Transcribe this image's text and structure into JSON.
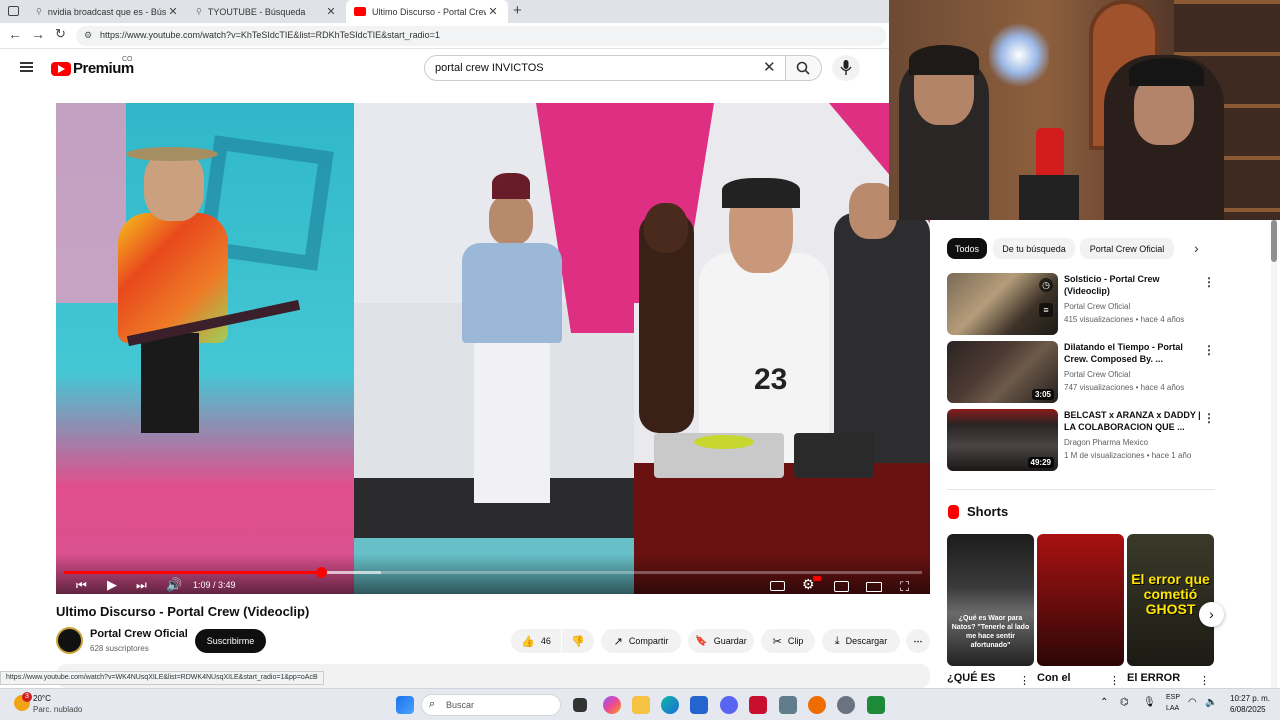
{
  "browser": {
    "tabs": [
      {
        "title": "nvidia broadcast que es - Búsqueda"
      },
      {
        "title": "TYOUTUBE - Búsqueda"
      },
      {
        "title": "Ultimo Discurso - Portal Crew (Videoclip)"
      }
    ],
    "url": "https://www.youtube.com/watch?v=KhTeSIdcTIE&list=RDKhTeSIdcTIE&start_radio=1",
    "status_url": "https://www.youtube.com/watch?v=WK4NUsqXILE&list=RDWK4NUsqXILE&start_radio=1&pp=oAcB"
  },
  "header": {
    "logo_text": "Premium",
    "country_code": "CO",
    "search_value": "portal crew INVICTOS"
  },
  "player": {
    "time": "1:09 / 3:49",
    "progress": 0.3,
    "buffered": 0.37
  },
  "video": {
    "title": "Ultimo Discurso - Portal Crew (Videoclip)",
    "channel": "Portal Crew Oficial",
    "subscribers": "628 suscriptores",
    "subscribe_label": "Suscribirme",
    "likes": "46",
    "share_label": "Compartir",
    "save_label": "Guardar",
    "clip_label": "Clip",
    "download_label": "Descargar"
  },
  "sidebar": {
    "chips": [
      "Todos",
      "De tu búsqueda",
      "Portal Crew Oficial"
    ],
    "recommendations": [
      {
        "title": "Solsticio - Portal Crew (Videoclip)",
        "channel": "Portal Crew Oficial",
        "meta": "415 visualizaciones • hace 4 años",
        "duration": ""
      },
      {
        "title": "Dilatando el Tiempo -  Portal Crew. Composed By. ...",
        "channel": "Portal Crew Oficial",
        "meta": "747 visualizaciones • hace 4 años",
        "duration": "3:05"
      },
      {
        "title": "BELCAST x ARANZA x DADDY | LA COLABORACION QUE ...",
        "channel": "Dragon Pharma Mexico",
        "meta": "1 M de visualizaciones • hace 1 año",
        "duration": "49:29"
      }
    ],
    "shorts_heading": "Shorts",
    "shorts": [
      {
        "title": "¿QUÉ ES",
        "overlay": "¿Qué es Waor para Natos? \"Tenerle al lado me hace sentir afortunado\""
      },
      {
        "title": "Con el",
        "overlay": ""
      },
      {
        "title": "El ERROR",
        "overlay": "El error que cometió GHOST"
      }
    ]
  },
  "taskbar": {
    "weather_temp": "20°C",
    "weather_desc": "Parc. nublado",
    "search_placeholder": "Buscar",
    "lang": "ESP",
    "lang2": "LAA",
    "time": "10:27 p. m.",
    "date": "6/08/2025",
    "weather_badge": "3"
  }
}
